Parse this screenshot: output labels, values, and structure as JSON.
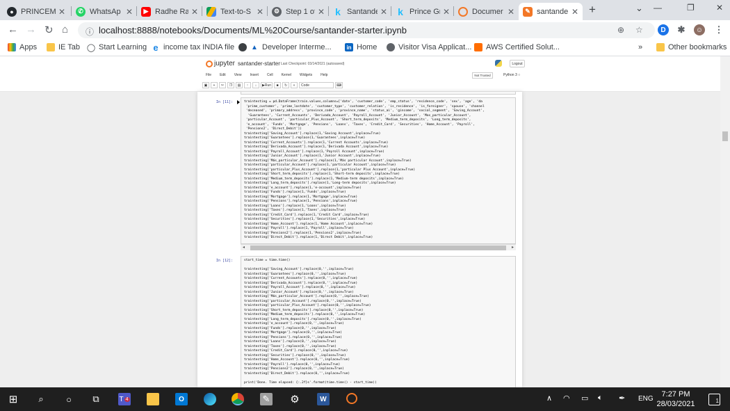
{
  "browser": {
    "tabs": [
      {
        "title": "PRINCEM",
        "icon": "github-icon",
        "color": "#24292e"
      },
      {
        "title": "WhatsAp",
        "icon": "whatsapp-icon",
        "color": "#25d366"
      },
      {
        "title": "Radhe Ra",
        "icon": "youtube-icon",
        "color": "#ff0000"
      },
      {
        "title": "Text-to-S",
        "icon": "google-drive-icon",
        "color": "#4285f4"
      },
      {
        "title": "Step 1 of",
        "icon": "step-icon",
        "color": "#5f6368"
      },
      {
        "title": "Santande",
        "icon": "kaggle-icon",
        "color": "#20beff"
      },
      {
        "title": "Prince Gr",
        "icon": "kaggle-icon",
        "color": "#20beff"
      },
      {
        "title": "Documer",
        "icon": "document-icon",
        "color": "#f37726"
      },
      {
        "title": "santande",
        "icon": "notebook-icon",
        "color": "#f37726"
      }
    ],
    "url": "localhost:8888/notebooks/Documents/ML%20Course/santander-starter.ipynb",
    "profile_initial": "D",
    "bookmarks": [
      {
        "label": "Apps",
        "icon": "apps-icon"
      },
      {
        "label": "IE Tab",
        "icon": "folder-icon"
      },
      {
        "label": "Start Learning",
        "icon": "learning-icon"
      },
      {
        "label": "income tax INDIA file",
        "icon": "ie-icon"
      },
      {
        "label": "Developer Interme...",
        "icon": "dev-icon"
      },
      {
        "label": "Home",
        "icon": "linkedin-icon"
      },
      {
        "label": "Visitor Visa Applicat...",
        "icon": "globe-icon"
      },
      {
        "label": "AWS Certified Solut...",
        "icon": "aws-icon"
      }
    ],
    "bookmarks_more": "»",
    "other_bookmarks": "Other bookmarks"
  },
  "jupyter": {
    "logo_text": "jupyter",
    "notebook_name": "santander-starter",
    "checkpoint": "Last Checkpoint: 03/14/2021  (autosaved)",
    "logout": "Logout",
    "menu": [
      "File",
      "Edit",
      "View",
      "Insert",
      "Cell",
      "Kernel",
      "Widgets",
      "Help"
    ],
    "trusted": "Not Trusted",
    "kernel": "Python 3",
    "toolbar": {
      "run": "Run",
      "cell_type": "Code"
    },
    "top_fragment": "...",
    "cells": [
      {
        "prompt": "In [11]:",
        "code": "traintesting = pd.DataFrame(train.values,columns=['date', 'customer_code', 'emp_status', 'residence_code', 'sex', 'age', 'da\n 'prime_customer', 'prime_lastdate', 'customer_type', 'customer_relation', 'is_residence', 'is_foreigner', 'spouse', 'channel\n 'deceased', 'primary_address', 'province_code', 'province_name', 'status_ai', 'gincome', 'social_segment', 'Saving_Account',\n  'Guarantees', 'Current_Accounts', 'Derivada_Account', 'Payroll_Account', 'Junior_Account', 'Mas_particular_Account',\n 'particular_Account', 'particular_Plus_Account', 'Short_term_deposits', 'Medium_term_deposits', 'Long_term_deposits',\n 'e_account', 'Funds', 'Mortgage', 'Pensions', 'Loans', 'Taxes', 'Credit_Card', 'Securities', 'Home_Account', 'Payroll',\n 'Pensions2', 'Direct_Debit'])\ntraintesting['Saving_Account'].replace(1,'Saving Account',inplace=True)\ntraintesting['Guarantees'].replace(1,'Guarantees',inplace=True)\ntraintesting['Current_Accounts'].replace(1,'Current Accounts',inplace=True)\ntraintesting['Derivada_Account'].replace(1,'Derivada Account',inplace=True)\ntraintesting['Payroll_Account'].replace(1,'Payroll Account',inplace=True)\ntraintesting['Junior_Account'].replace(1,'Junior Account',inplace=True)\ntraintesting['Más_particular_Account'].replace(1,'Más particular Account',inplace=True)\ntraintesting['particular_Account'].replace(1,'particular Account',inplace=True)\ntraintesting['particular_Plus_Account'].replace(1,'particular Plus Account',inplace=True)\ntraintesting['Short_term_deposits'].replace(1,'Short-term deposits',inplace=True)\ntraintesting['Medium_term_deposits'].replace(1,'Medium-term deposits',inplace=True)\ntraintesting['Long_term_deposits'].replace(1,'Long-term deposits',inplace=True)\ntraintesting['e_account'].replace(1,'e-account',inplace=True)\ntraintesting['Funds'].replace(1,'Funds',inplace=True)\ntraintesting['Mortgage'].replace(1,'Mortgage',inplace=True)\ntraintesting['Pensions'].replace(1,'Pensions',inplace=True)\ntraintesting['Loans'].replace(1,'Loans',inplace=True)\ntraintesting['Taxes'].replace(1,'Taxes',inplace=True)\ntraintesting['Credit_Card'].replace(1,'Credit Card',inplace=True)\ntraintesting['Securities'].replace(1,'Securities',inplace=True)\ntraintesting['Home_Account'].replace(1,'Home Account',inplace=True)\ntraintesting['Payroll'].replace(1,'Payroll',inplace=True)\ntraintesting['Pensions2'].replace(1,'Pensions2',inplace=True)\ntraintesting['Direct_Debit'].replace(1,'Direct Debit',inplace=True)"
      },
      {
        "prompt": "In [12]:",
        "code": "start_time = time.time()\n\ntraintesting['Saving_Account'].replace(0,'',inplace=True)\ntraintesting['Guarantees'].replace(0,'',inplace=True)\ntraintesting['Current_Accounts'].replace(0,'',inplace=True)\ntraintesting['Derivada_Account'].replace(0,'',inplace=True)\ntraintesting['Payroll_Account'].replace(0,'',inplace=True)\ntraintesting['Junior_Account'].replace(0,'',inplace=True)\ntraintesting['Más_particular_Account'].replace(0,'',inplace=True)\ntraintesting['particular_Account'].replace(0,'',inplace=True)\ntraintesting['particular_Plus_Account'].replace(0,'',inplace=True)\ntraintesting['Short_term_deposits'].replace(0,'',inplace=True)\ntraintesting['Medium_term_deposits'].replace(0,'',inplace=True)\ntraintesting['Long_term_deposits'].replace(0,'',inplace=True)\ntraintesting['e_account'].replace(0,'',inplace=True)\ntraintesting['Funds'].replace(0,'',inplace=True)\ntraintesting['Mortgage'].replace(0,'',inplace=True)\ntraintesting['Pensions'].replace(0,'',inplace=True)\ntraintesting['Loans'].replace(0,'',inplace=True)\ntraintesting['Taxes'].replace(0,'',inplace=True)\ntraintesting['Credit_Card'].replace(0,'',inplace=True)\ntraintesting['Securities'].replace(0,'',inplace=True)\ntraintesting['Home_Account'].replace(0,'',inplace=True)\ntraintesting['Payroll'].replace(0,'',inplace=True)\ntraintesting['Pensions2'].replace(0,'',inplace=True)\ntraintesting['Direct_Debit'].replace(0,'',inplace=True)\n\nprint('Done. Time elapsed: {:.2f}s'.format(time.time() - start_time))"
      }
    ]
  },
  "taskbar": {
    "language": "ENG",
    "time": "7:27 PM",
    "date": "28/03/2021",
    "teams_badge": "4",
    "notification_count": "1"
  }
}
